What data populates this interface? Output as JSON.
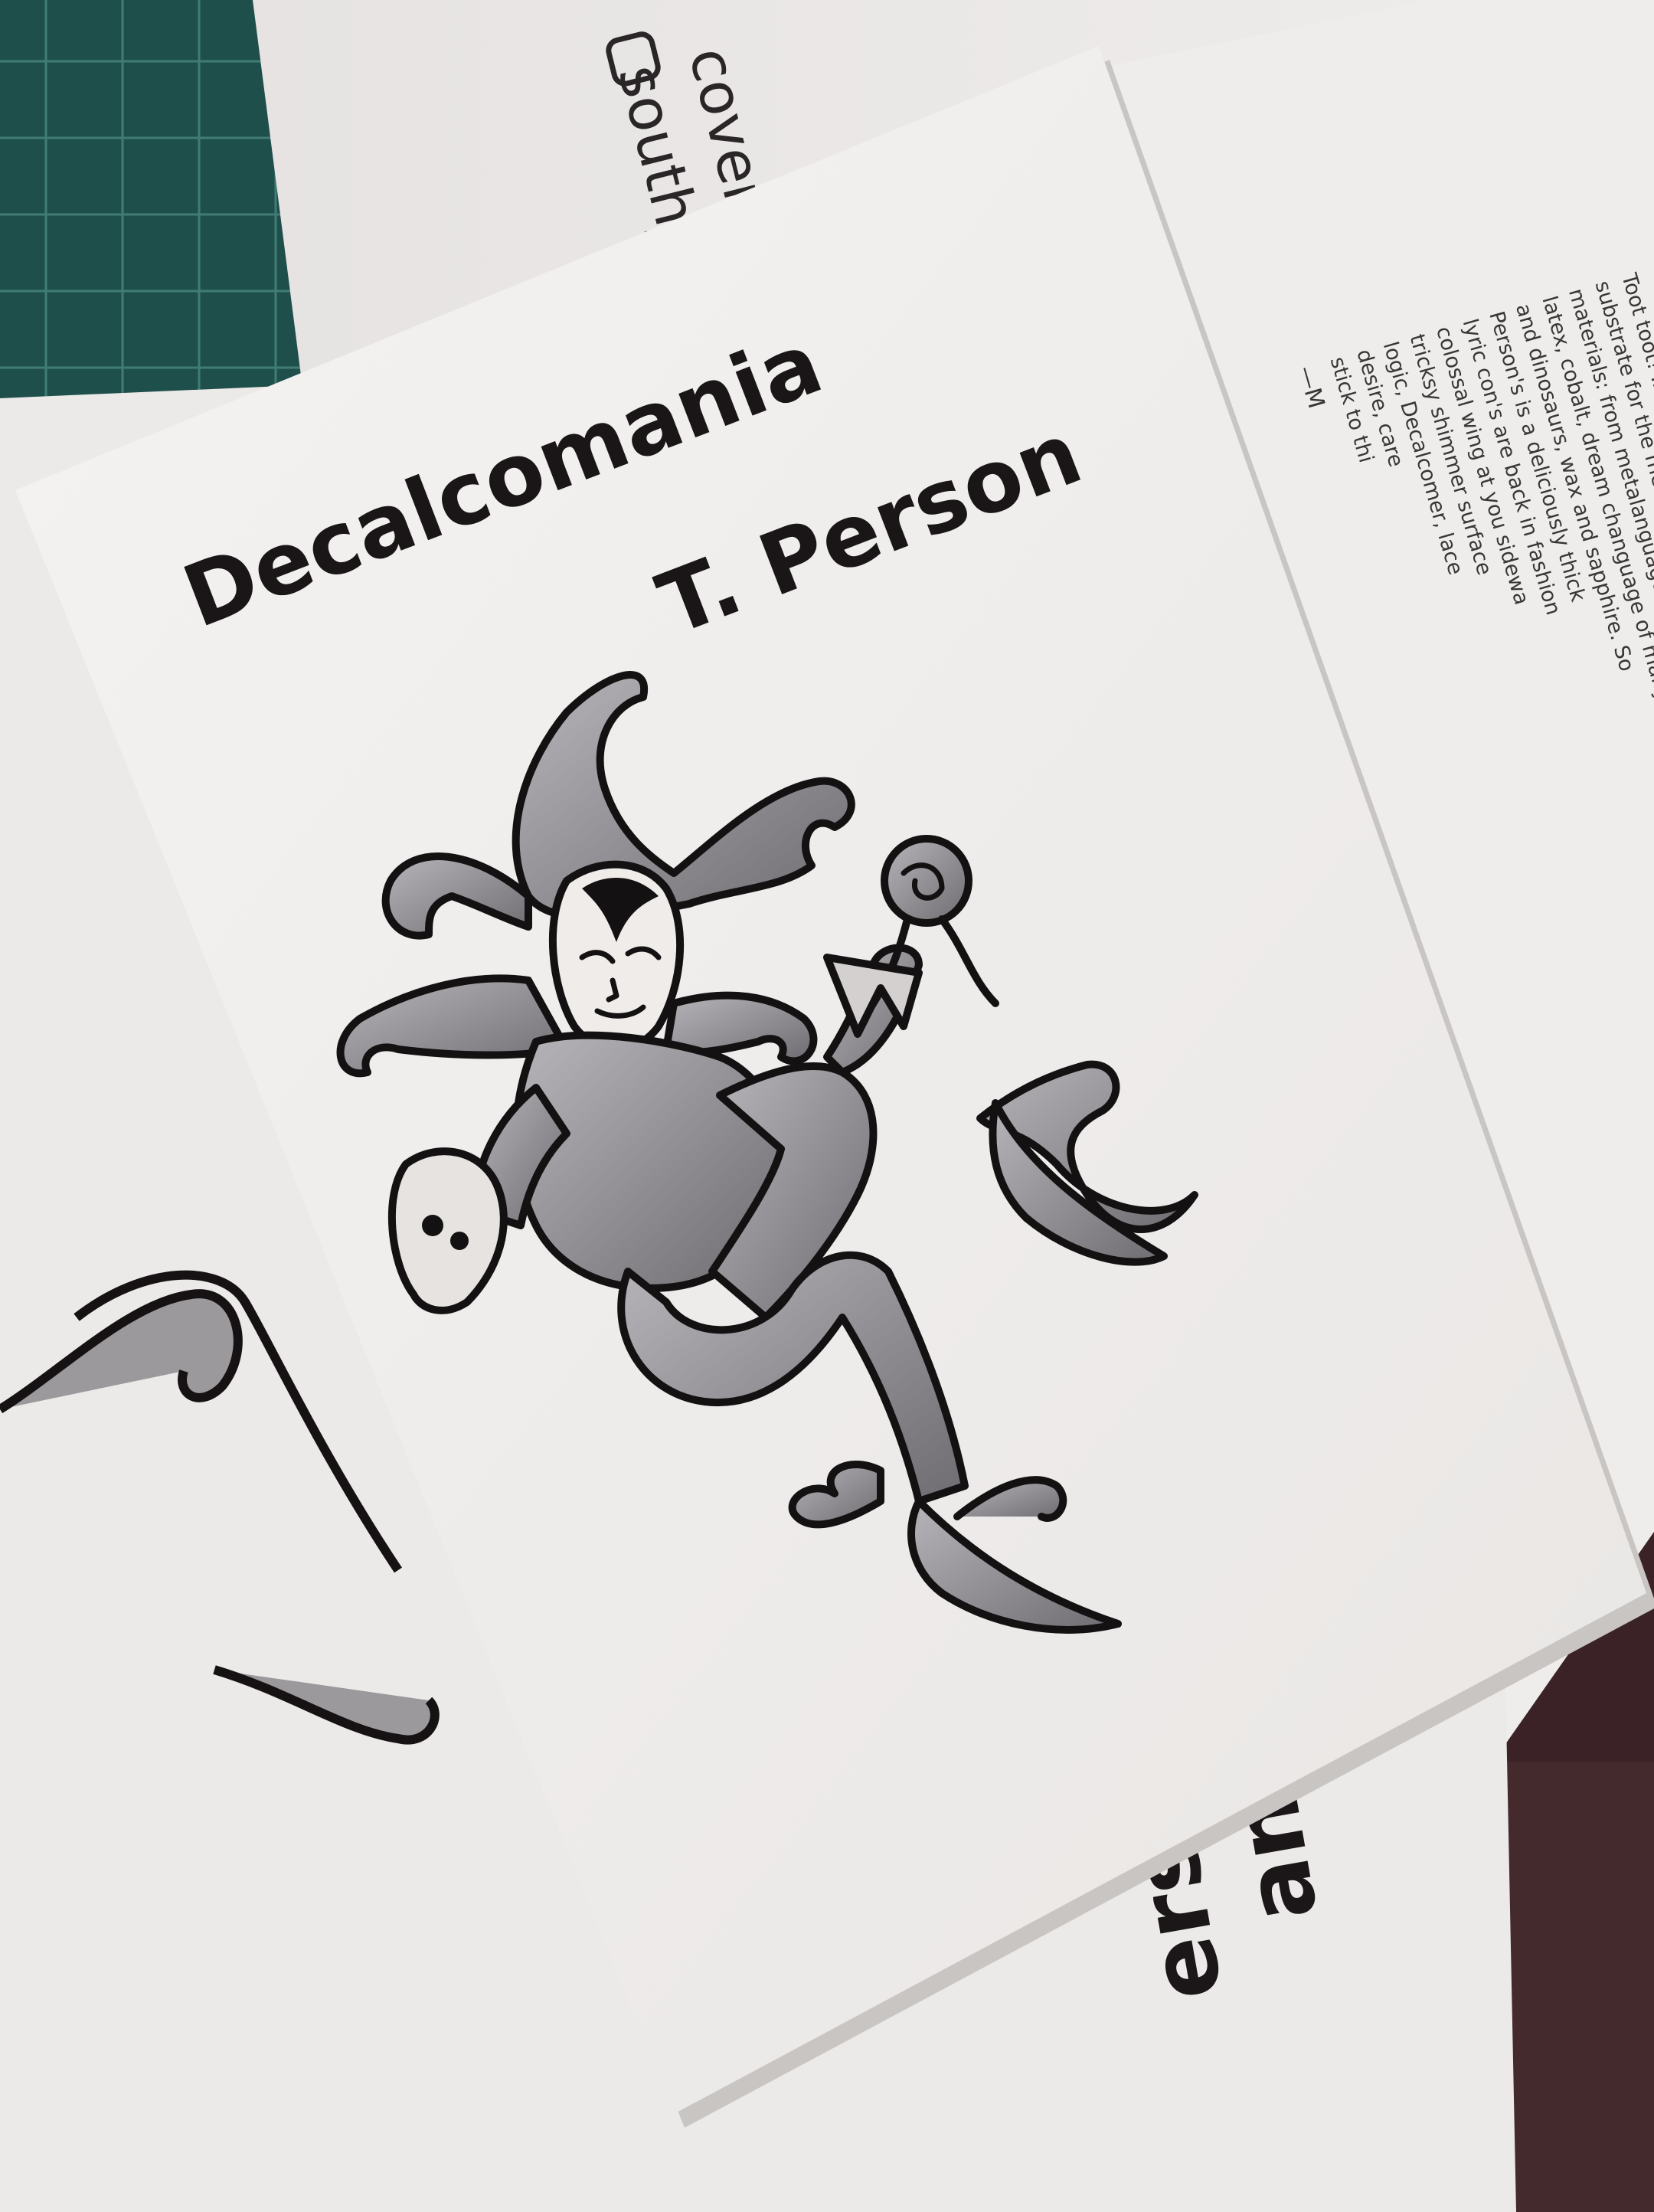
{
  "scene": {
    "description_colors": {
      "mat": "#1f4f4b",
      "mat_grid": "#3f7f78",
      "cloth": "#3a2226",
      "paper": "#f1efee",
      "paper_shadow": "#d8d4d2",
      "ink": "#161213",
      "wash": "#8d8a8e"
    },
    "front_zine": {
      "title": "Decalcomania",
      "author": "T. Person"
    },
    "back_sheet_top": {
      "line1": "cover",
      "line2": "south_"
    },
    "right_sheet_text": {
      "lines": [
        "Toot toot! In this wily",
        "substrate for the metal",
        "materials: from metalanguage of pamphlet",
        "latex, cobalt, dream changuage of manyl",
        "and dinosaurs, wax and sapphire. So",
        "Person's is a deliciously thick",
        "lyric con's are back in fashion",
        "colossal wing at you sidewa",
        "tricksy shimmer surface",
        "logic, Decalcomer, lace",
        "desire, care",
        "stick to thi",
        "—M"
      ]
    },
    "bottom_zine_mirrored": {
      "line1": "ania",
      "line2": "erson"
    }
  }
}
